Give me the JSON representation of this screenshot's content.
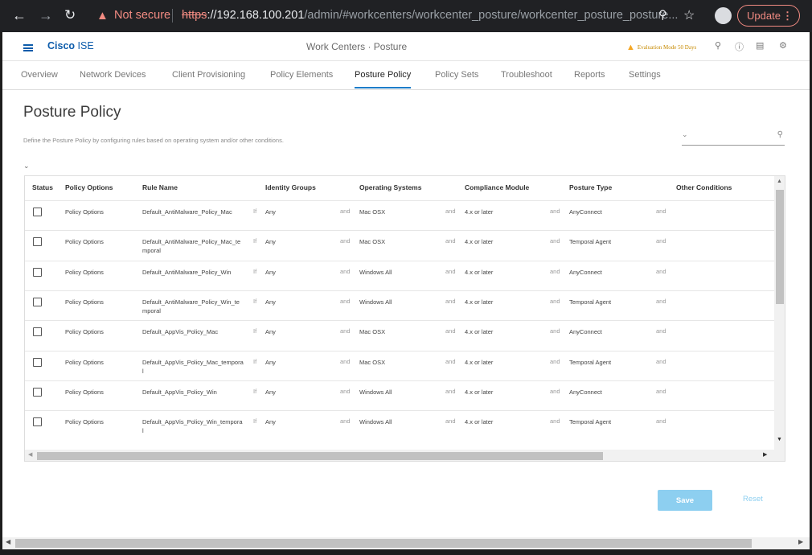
{
  "browser": {
    "warning": "Not secure",
    "url_scheme": "https",
    "url_host": "://192.168.100.201",
    "url_path": "/admin/#workcenters/workcenter_posture/workcenter_posture_posture...",
    "update_label": "Update"
  },
  "header": {
    "brand_bold": "Cisco",
    "brand_light": "ISE",
    "center_title": "Work Centers · Posture",
    "evaluation": "Evaluation Mode 50 Days"
  },
  "tabs": [
    "Overview",
    "Network Devices",
    "Client Provisioning",
    "Policy Elements",
    "Posture Policy",
    "Policy Sets",
    "Troubleshoot",
    "Reports",
    "Settings"
  ],
  "active_tab": "Posture Policy",
  "page": {
    "title": "Posture Policy",
    "description": "Define the Posture Policy by configuring rules based on operating system and/or other conditions."
  },
  "table": {
    "headers": {
      "status": "Status",
      "policy_options": "Policy Options",
      "rule_name": "Rule Name",
      "identity_groups": "Identity Groups",
      "operating_systems": "Operating Systems",
      "compliance_module": "Compliance Module",
      "posture_type": "Posture Type",
      "other_conditions": "Other Conditions"
    },
    "if_word": "If",
    "and_word": "and",
    "rows": [
      {
        "options": "Policy Options",
        "rule": "Default_AntiMalware_Policy_Mac",
        "identity": "Any",
        "os": "Mac OSX",
        "compliance": "4.x or later",
        "posture": "AnyConnect"
      },
      {
        "options": "Policy Options",
        "rule": "Default_AntiMalware_Policy_Mac_temporal",
        "identity": "Any",
        "os": "Mac OSX",
        "compliance": "4.x or later",
        "posture": "Temporal Agent"
      },
      {
        "options": "Policy Options",
        "rule": "Default_AntiMalware_Policy_Win",
        "identity": "Any",
        "os": "Windows All",
        "compliance": "4.x or later",
        "posture": "AnyConnect"
      },
      {
        "options": "Policy Options",
        "rule": "Default_AntiMalware_Policy_Win_temporal",
        "identity": "Any",
        "os": "Windows All",
        "compliance": "4.x or later",
        "posture": "Temporal Agent"
      },
      {
        "options": "Policy Options",
        "rule": "Default_AppVis_Policy_Mac",
        "identity": "Any",
        "os": "Mac OSX",
        "compliance": "4.x or later",
        "posture": "AnyConnect"
      },
      {
        "options": "Policy Options",
        "rule": "Default_AppVis_Policy_Mac_temporal",
        "identity": "Any",
        "os": "Mac OSX",
        "compliance": "4.x or later",
        "posture": "Temporal Agent"
      },
      {
        "options": "Policy Options",
        "rule": "Default_AppVis_Policy_Win",
        "identity": "Any",
        "os": "Windows All",
        "compliance": "4.x or later",
        "posture": "AnyConnect"
      },
      {
        "options": "Policy Options",
        "rule": "Default_AppVis_Policy_Win_temporal",
        "identity": "Any",
        "os": "Windows All",
        "compliance": "4.x or later",
        "posture": "Temporal Agent"
      }
    ]
  },
  "footer": {
    "save": "Save",
    "reset": "Reset"
  },
  "colors": {
    "accent": "#1d7dc9",
    "brand": "#0d5cab",
    "save_bg": "#8dcff0",
    "warning": "#f28b82"
  }
}
